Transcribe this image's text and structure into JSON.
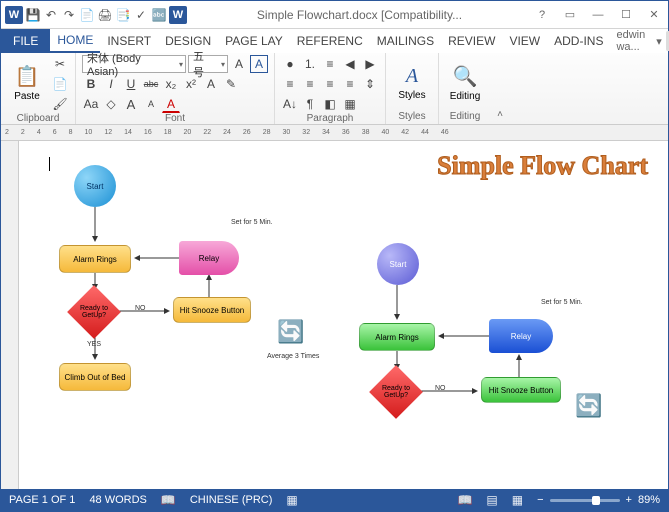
{
  "titlebar": {
    "app_icon": "W",
    "title": "Simple Flowchart.docx [Compatibility...",
    "help": "?"
  },
  "qat": {
    "save": "💾",
    "undo": "↶",
    "redo": "↷",
    "a": "📄",
    "b": "🖨",
    "c": "📑",
    "d": "✓",
    "e": "🔤"
  },
  "tabs": {
    "file": "FILE",
    "items": [
      "HOME",
      "INSERT",
      "DESIGN",
      "PAGE LAY",
      "REFERENC",
      "MAILINGS",
      "REVIEW",
      "VIEW",
      "ADD-INS"
    ],
    "active": 0
  },
  "user": {
    "name": "edwin wa...",
    "menu": "▾"
  },
  "ribbon": {
    "clipboard": {
      "label": "Clipboard",
      "paste": "Paste",
      "paste_ico": "📋",
      "cut": "✂",
      "copy": "📄",
      "fmt": "🖌"
    },
    "font": {
      "label": "Font",
      "family": "宋体 (Body Asian)",
      "size": "五号",
      "grow": "A",
      "shrink": "A",
      "case": "Aa",
      "clear": "◇",
      "b": "B",
      "i": "I",
      "u": "U",
      "strike": "abc",
      "sub": "x₂",
      "sup": "x²",
      "fx": "A",
      "hl": "✎",
      "color": "A"
    },
    "para": {
      "label": "Paragraph",
      "bul": "⦁",
      "num": "1.",
      "ml": "≡",
      "dedent": "◀",
      "indent": "▶",
      "sort": "A↓",
      "pilcrow": "¶",
      "al1": "≡",
      "al2": "≡",
      "al3": "≡",
      "al4": "≡",
      "ls": "⇕",
      "shade": "◧",
      "border": "▦"
    },
    "styles": {
      "label": "Styles",
      "ico": "A",
      "text": "Styles"
    },
    "editing": {
      "label": "Editing",
      "ico": "🔍",
      "text": "Editing"
    }
  },
  "ruler": {
    "marks": [
      "2",
      "2",
      "4",
      "6",
      "8",
      "10",
      "12",
      "14",
      "16",
      "18",
      "20",
      "22",
      "24",
      "26",
      "28",
      "30",
      "32",
      "34",
      "36",
      "38",
      "40",
      "42",
      "44",
      "46",
      "46"
    ]
  },
  "doc": {
    "title": "Simple Flow Chart",
    "left": {
      "start": "Start",
      "alarm": "Alarm Rings",
      "relay": "Relay",
      "ready": "Ready to GetUp?",
      "snooze": "Hit Snooze Button",
      "climb": "Climb Out of Bed",
      "no": "NO",
      "yes": "YES",
      "avg": "Average 3 Times",
      "set": "Set for 5 Min."
    },
    "right": {
      "start": "Start",
      "alarm": "Alarm Rings",
      "relay": "Relay",
      "ready": "Ready to GetUp?",
      "snooze": "Hit Snooze Button",
      "no": "NO",
      "set": "Set for 5 Min."
    }
  },
  "status": {
    "page": "PAGE 1 OF 1",
    "words": "48 WORDS",
    "lang": "CHINESE (PRC)",
    "zoom_minus": "−",
    "zoom_plus": "+",
    "zoom": "89%"
  }
}
